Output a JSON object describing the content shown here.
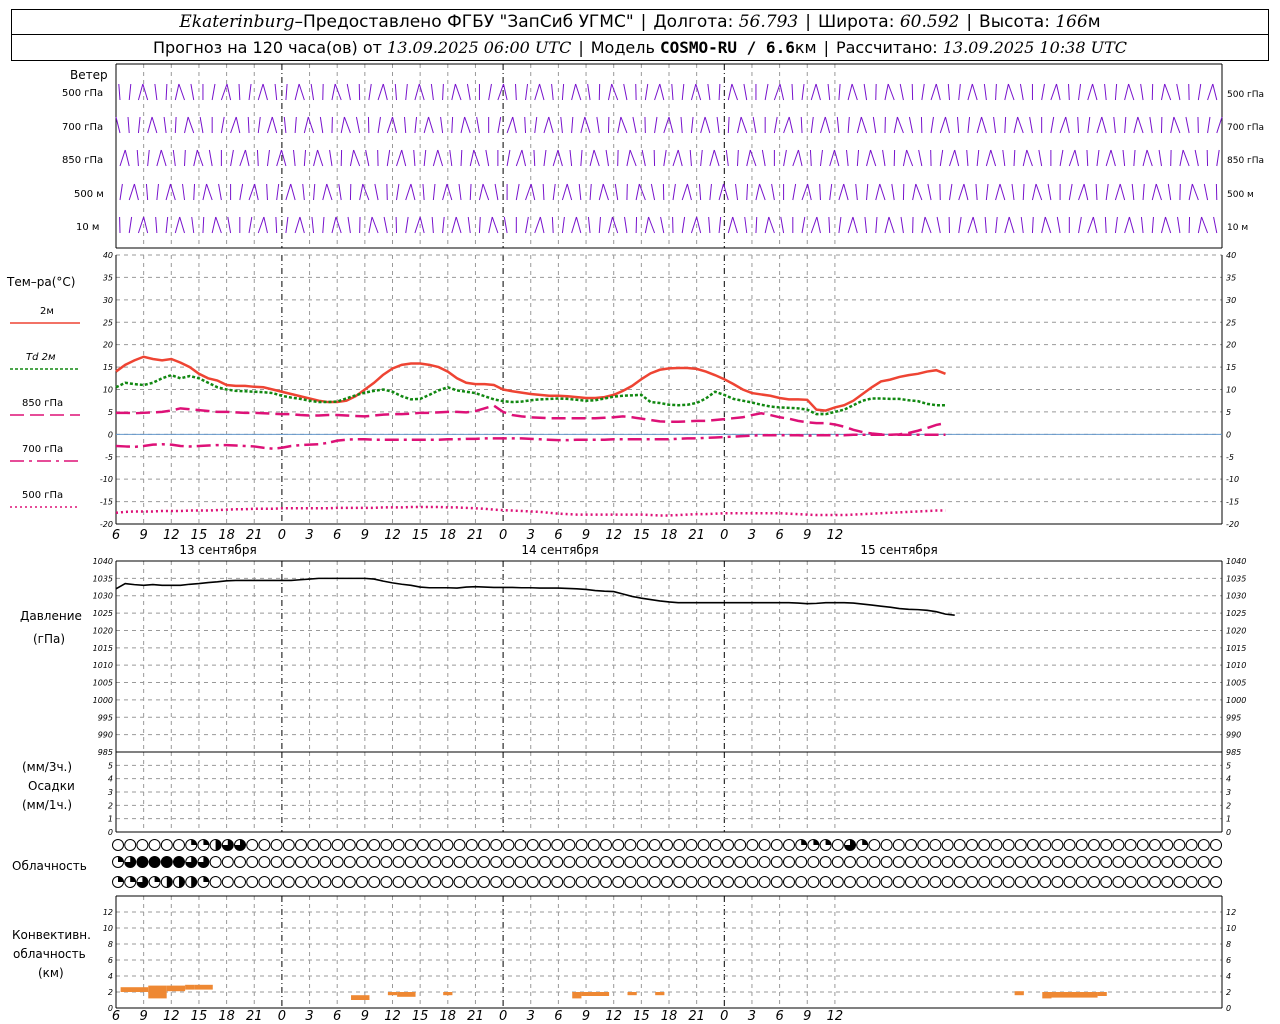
{
  "header": {
    "station": "Ekaterinburg",
    "dash": " – ",
    "provider": "Предоставлено ФГБУ \"ЗапСиб УГМС\"",
    "lon_label": "Долгота:",
    "lon": "56.793",
    "lat_label": "Широта:",
    "lat": "60.592",
    "alt_label": "Высота:",
    "alt": "166",
    "alt_unit": "м",
    "forecast_label": "Прогноз на 120 часа(ов) от",
    "forecast_start": "13.09.2025 06:00 UTC",
    "model_label": "Модель",
    "model": "COSMO-RU / 6.6",
    "model_unit": "км",
    "calc_label": "Рассчитано:",
    "calc_time": "13.09.2025 10:38 UTC"
  },
  "labels": {
    "wind": "Ветер",
    "wind_levels": [
      "500 гПа",
      "700 гПа",
      "850 гПа",
      "500 м",
      "10  м"
    ],
    "temp": "Тем–ра(°C)",
    "temp_series": [
      "2м",
      "Td  2м",
      "850 гПа",
      "700 гПа",
      "500 гПа"
    ],
    "pressure": "Давление",
    "pressure_unit": "(гПа)",
    "precip_unit3": "(мм/3ч.)",
    "precip": "Осадки",
    "precip_unit1": "(мм/1ч.)",
    "cloud": "Облачность",
    "conv1": "Конвективн.",
    "conv2": "облачность",
    "conv3": "(км)"
  },
  "colors": {
    "t2m": "#ee4433",
    "td2m": "#118811",
    "t850": "#dd1177",
    "t700": "#dd1177",
    "t500": "#dd1177",
    "wind": "#7711cc",
    "pressure": "#000000",
    "conv": "#ee8833"
  },
  "chart_data": [
    {
      "type": "line",
      "name": "temperature",
      "x_hours": [
        6,
        7,
        8,
        9,
        10,
        11,
        12,
        13,
        14,
        15,
        16,
        17,
        18,
        19,
        20,
        21,
        22,
        23,
        24,
        25,
        26,
        27,
        28,
        29,
        30,
        31,
        32,
        33,
        34,
        35,
        36,
        37,
        38,
        39,
        40,
        41,
        42,
        43,
        44,
        45,
        46,
        47,
        48,
        49,
        50,
        51,
        52,
        53,
        54,
        55,
        56,
        57,
        58,
        59,
        60,
        61,
        62,
        63,
        64,
        65,
        66,
        67,
        68,
        69,
        70,
        71,
        72,
        73,
        74,
        75,
        76,
        77,
        78,
        79,
        80,
        81,
        82,
        83,
        84,
        85,
        86,
        87,
        88,
        89,
        90,
        91,
        92,
        93,
        94,
        95,
        96,
        97,
        98,
        99,
        100,
        101,
        102,
        103,
        104,
        105,
        106,
        107,
        108,
        109,
        110,
        111,
        112,
        113,
        114,
        115,
        116,
        117,
        118,
        119,
        120,
        121,
        122,
        123,
        124,
        125,
        126
      ],
      "ylim": [
        -20,
        40
      ],
      "yticks": [
        -20,
        -15,
        -10,
        -5,
        0,
        5,
        10,
        15,
        20,
        25,
        30,
        35,
        40
      ],
      "series": [
        {
          "name": "2м",
          "values": [
            14,
            15.5,
            16.5,
            17.3,
            16.8,
            16.5,
            16.8,
            16,
            15,
            13.5,
            12.5,
            12,
            11,
            10.8,
            10.8,
            10.6,
            10.5,
            10,
            9.5,
            9,
            8.5,
            8,
            7.5,
            7.2,
            7.2,
            7.5,
            8.5,
            10,
            11.5,
            13.3,
            14.7,
            15.5,
            15.8,
            15.8,
            15.5,
            15,
            14,
            12.5,
            11.5,
            11.2,
            11.2,
            11,
            10,
            9.6,
            9.3,
            9,
            8.8,
            8.6,
            8.6,
            8.5,
            8.3,
            8.1,
            8.1,
            8.3,
            8.8,
            9.7,
            10.8,
            12.3,
            13.6,
            14.4,
            14.7,
            14.8,
            14.8,
            14.6,
            14,
            13.2,
            12.3,
            11.2,
            10,
            9.2,
            8.9,
            8.6,
            8.1,
            7.8,
            7.8,
            7.7,
            5.5,
            5.3,
            6,
            6.5,
            7.5,
            9,
            10.5,
            11.8,
            12.2,
            12.8,
            13.2,
            13.5,
            14,
            14.3,
            13.5
          ]
        },
        {
          "name": "Td  2м",
          "values": [
            10.5,
            11.5,
            11.2,
            11,
            11.5,
            12.5,
            13.2,
            12.5,
            13,
            12.5,
            11.5,
            10.5,
            10,
            9.7,
            9.6,
            9.5,
            9.4,
            9.2,
            8.6,
            8.2,
            7.9,
            7.5,
            7.2,
            7.2,
            7.3,
            8,
            8.7,
            9.3,
            9.7,
            10,
            9.5,
            8.5,
            7.8,
            7.9,
            8.8,
            9.8,
            10.5,
            9.8,
            9.5,
            9.2,
            8.5,
            7.8,
            7.4,
            7.2,
            7.3,
            7.6,
            7.8,
            7.9,
            8,
            7.9,
            7.7,
            7.5,
            7.6,
            8,
            8.4,
            8.6,
            8.7,
            8.8,
            7.2,
            7,
            6.6,
            6.5,
            6.6,
            7,
            8,
            9.5,
            8.8,
            7.9,
            7.5,
            7.1,
            6.6,
            6.2,
            6,
            5.9,
            5.8,
            5.5,
            4.5,
            4.5,
            5,
            5.5,
            6.5,
            7.5,
            8,
            8,
            7.9,
            7.9,
            7.6,
            7.4,
            6.8,
            6.5,
            6.5
          ]
        },
        {
          "name": "850 гПа",
          "values": [
            4.8,
            4.8,
            4.7,
            4.8,
            4.9,
            5,
            5.3,
            5.8,
            5.6,
            5.4,
            5.2,
            5,
            5,
            4.9,
            4.8,
            4.8,
            4.7,
            4.6,
            4.5,
            4.5,
            4.3,
            4.2,
            4.2,
            4.3,
            4.3,
            4.2,
            4.1,
            4,
            4.2,
            4.4,
            4.5,
            4.5,
            4.6,
            4.8,
            4.8,
            4.9,
            5,
            5,
            4.9,
            5.2,
            5.8,
            6.4,
            5,
            4.3,
            4,
            3.8,
            3.7,
            3.6,
            3.6,
            3.6,
            3.6,
            3.6,
            3.6,
            3.7,
            3.8,
            4,
            3.8,
            3.5,
            3.2,
            2.9,
            2.8,
            2.8,
            2.9,
            3,
            3,
            3.2,
            3.4,
            3.6,
            3.8,
            4.3,
            4.7,
            4.3,
            3.8,
            3.5,
            3,
            2.7,
            2.5,
            2.5,
            2.2,
            1.7,
            1,
            0.5,
            0.2,
            0,
            -0.1,
            0,
            0.3,
            0.8,
            1.4,
            2.1,
            2.5
          ]
        },
        {
          "name": "700 гПа",
          "values": [
            -2.6,
            -2.7,
            -2.8,
            -2.6,
            -2.3,
            -2.2,
            -2.3,
            -2.6,
            -2.7,
            -2.6,
            -2.5,
            -2.4,
            -2.4,
            -2.5,
            -2.6,
            -2.7,
            -3,
            -3.2,
            -3,
            -2.6,
            -2.4,
            -2.3,
            -2.2,
            -1.9,
            -1.4,
            -1.2,
            -1.1,
            -1.1,
            -1.2,
            -1.2,
            -1.2,
            -1.2,
            -1.2,
            -1.2,
            -1.2,
            -1.2,
            -1.1,
            -1.1,
            -1,
            -1,
            -0.9,
            -0.9,
            -0.9,
            -0.9,
            -0.9,
            -1,
            -1.1,
            -1.2,
            -1.3,
            -1.3,
            -1.2,
            -1.2,
            -1.2,
            -1.2,
            -1.1,
            -1.1,
            -1.1,
            -1.1,
            -1.1,
            -1.1,
            -1.1,
            -1,
            -0.9,
            -0.9,
            -0.8,
            -0.7,
            -0.6,
            -0.5,
            -0.4,
            -0.3,
            -0.2,
            -0.2,
            -0.2,
            -0.2,
            -0.2,
            -0.3,
            -0.2,
            -0.2,
            -0.2,
            -0.2,
            -0.1,
            -0.1,
            -0.1,
            -0.1,
            -0.1,
            -0.1,
            -0.1,
            -0.1,
            -0.1,
            -0.1,
            -0.1
          ]
        },
        {
          "name": "500 гПа",
          "values": [
            -17.5,
            -17.3,
            -17.2,
            -17.2,
            -17.2,
            -17.1,
            -17.1,
            -17.1,
            -17,
            -17,
            -17,
            -16.9,
            -16.8,
            -16.7,
            -16.7,
            -16.6,
            -16.6,
            -16.6,
            -16.5,
            -16.5,
            -16.5,
            -16.5,
            -16.5,
            -16.5,
            -16.4,
            -16.4,
            -16.4,
            -16.4,
            -16.4,
            -16.3,
            -16.3,
            -16.3,
            -16.2,
            -16.2,
            -16.2,
            -16.2,
            -16.3,
            -16.3,
            -16.4,
            -16.5,
            -16.6,
            -16.8,
            -16.9,
            -17,
            -17.1,
            -17.2,
            -17.3,
            -17.5,
            -17.7,
            -17.8,
            -17.9,
            -17.9,
            -17.9,
            -17.9,
            -17.9,
            -17.9,
            -17.9,
            -17.9,
            -18,
            -18.1,
            -18.1,
            -18,
            -17.9,
            -17.8,
            -17.8,
            -17.7,
            -17.6,
            -17.6,
            -17.6,
            -17.6,
            -17.6,
            -17.6,
            -17.6,
            -17.7,
            -17.8,
            -17.9,
            -18,
            -18,
            -18,
            -18,
            -17.9,
            -17.8,
            -17.7,
            -17.6,
            -17.5,
            -17.4,
            -17.3,
            -17.2,
            -17.1,
            -17,
            -17
          ]
        }
      ]
    },
    {
      "type": "line",
      "name": "pressure",
      "x_hours": [
        6,
        7,
        8,
        9,
        10,
        11,
        12,
        13,
        14,
        15,
        16,
        17,
        18,
        19,
        20,
        21,
        22,
        23,
        24,
        25,
        26,
        27,
        28,
        29,
        30,
        31,
        32,
        33,
        34,
        35,
        36,
        37,
        38,
        39,
        40,
        41,
        42,
        43,
        44,
        45,
        46,
        47,
        48,
        49,
        50,
        51,
        52,
        53,
        54,
        55,
        56,
        57,
        58,
        59,
        60,
        61,
        62,
        63,
        64,
        65,
        66,
        67,
        68,
        69,
        70,
        71,
        72,
        73,
        74,
        75,
        76,
        77,
        78,
        79,
        80,
        81,
        82,
        83,
        84,
        85,
        86,
        87,
        88,
        89,
        90,
        91,
        92,
        93,
        94,
        95,
        96,
        97,
        98,
        99,
        100,
        101,
        102,
        103,
        104,
        105,
        106,
        107,
        108,
        109,
        110,
        111,
        112,
        113,
        114,
        115,
        116,
        117,
        118,
        119,
        120,
        121,
        122,
        123,
        124,
        125,
        126
      ],
      "ylim": [
        985,
        1040
      ],
      "yticks": [
        985,
        990,
        995,
        1000,
        1005,
        1010,
        1015,
        1020,
        1025,
        1030,
        1035,
        1040
      ],
      "series": [
        {
          "name": "",
          "values": [
            1032,
            1033.5,
            1033.2,
            1033,
            1033.2,
            1033,
            1033,
            1033,
            1033.3,
            1033.5,
            1033.8,
            1034,
            1034.3,
            1034.4,
            1034.4,
            1034.4,
            1034.4,
            1034.4,
            1034.4,
            1034.4,
            1034.6,
            1034.8,
            1035,
            1035,
            1035,
            1035,
            1035,
            1035,
            1034.8,
            1034.2,
            1033.7,
            1033.3,
            1033,
            1032.5,
            1032.3,
            1032.3,
            1032.3,
            1032.2,
            1032.5,
            1032.6,
            1032.5,
            1032.4,
            1032.4,
            1032.4,
            1032.3,
            1032.3,
            1032.2,
            1032.2,
            1032.2,
            1032.1,
            1032,
            1031.8,
            1031.5,
            1031.3,
            1031.2,
            1030.5,
            1029.8,
            1029.3,
            1028.9,
            1028.5,
            1028.2,
            1028,
            1028,
            1028,
            1028,
            1028,
            1028,
            1028,
            1028,
            1028,
            1028,
            1028,
            1028,
            1028,
            1027.9,
            1027.7,
            1027.8,
            1028,
            1028,
            1028,
            1027.9,
            1027.6,
            1027.3,
            1027,
            1026.7,
            1026.3,
            1026.1,
            1026,
            1025.8,
            1025.4,
            1024.7,
            1024.4
          ]
        }
      ]
    },
    {
      "type": "bar",
      "name": "convective clouds",
      "ylim": [
        0,
        14
      ],
      "yticks": [
        0,
        2,
        4,
        6,
        8,
        10,
        12
      ],
      "bars": [
        {
          "x0": 6.5,
          "x1": 9.5,
          "bottom": 2.0,
          "top": 2.6
        },
        {
          "x0": 9.5,
          "x1": 11.5,
          "bottom": 1.2,
          "top": 2.8
        },
        {
          "x0": 11.5,
          "x1": 13.5,
          "bottom": 2.1,
          "top": 2.8
        },
        {
          "x0": 13.5,
          "x1": 14.5,
          "bottom": 2.3,
          "top": 2.9
        },
        {
          "x0": 14.5,
          "x1": 16.5,
          "bottom": 2.3,
          "top": 2.9
        },
        {
          "x0": 31.5,
          "x1": 33.5,
          "bottom": 1.0,
          "top": 1.6
        },
        {
          "x0": 35.5,
          "x1": 36.5,
          "bottom": 1.6,
          "top": 2.0
        },
        {
          "x0": 36.5,
          "x1": 38.5,
          "bottom": 1.4,
          "top": 2.0
        },
        {
          "x0": 41.5,
          "x1": 42.5,
          "bottom": 1.6,
          "top": 2.0
        },
        {
          "x0": 55.5,
          "x1": 56.5,
          "bottom": 1.2,
          "top": 2.0
        },
        {
          "x0": 56.5,
          "x1": 59.5,
          "bottom": 1.5,
          "top": 2.0
        },
        {
          "x0": 61.5,
          "x1": 62.5,
          "bottom": 1.6,
          "top": 2.0
        },
        {
          "x0": 64.5,
          "x1": 65.5,
          "bottom": 1.6,
          "top": 2.0
        },
        {
          "x0": 103.5,
          "x1": 104.5,
          "bottom": 1.6,
          "top": 2.1
        },
        {
          "x0": 106.5,
          "x1": 107.5,
          "bottom": 1.2,
          "top": 2.0
        },
        {
          "x0": 107.5,
          "x1": 112.5,
          "bottom": 1.3,
          "top": 2.0
        },
        {
          "x0": 112.5,
          "x1": 113.5,
          "bottom": 1.5,
          "top": 2.0
        }
      ]
    },
    {
      "type": "bar",
      "name": "precipitation",
      "ylim": [
        0,
        6
      ],
      "yticks": [
        0,
        1,
        2,
        3,
        4,
        5
      ],
      "values": []
    }
  ],
  "axis": {
    "hour_ticks": [
      "6",
      "9",
      "12",
      "15",
      "18",
      "21",
      "0",
      "3",
      "6",
      "9",
      "12",
      "15",
      "18",
      "21",
      "0",
      "3",
      "6",
      "9",
      "12",
      "15",
      "18",
      "21",
      "0",
      "3",
      "6",
      "9",
      "12"
    ],
    "dates": [
      "13 сентября",
      "14 сентября",
      "15 сентября"
    ]
  },
  "clouds": {
    "rows": [
      "0000001123300000000000000000000000000000000000000000000011103100000000000000000000000000000000000000000000000000000000000000000000000000000000000000000000000000000000000000000000000000000000000000000000",
      "1344443300000000000000000000000000000000000000000000000000000000000000000000000000000000000000000000000000000000000000000000000000000000000000000000000000000000000000000000000000000000000000000000000000",
      "1131222100000000000000000000000000000000000000000000000000000000000000000000000000000000000000000000000000000000000000000000000000000000000000000000000000000000000000000000000000000000000000000000000000"
    ]
  }
}
